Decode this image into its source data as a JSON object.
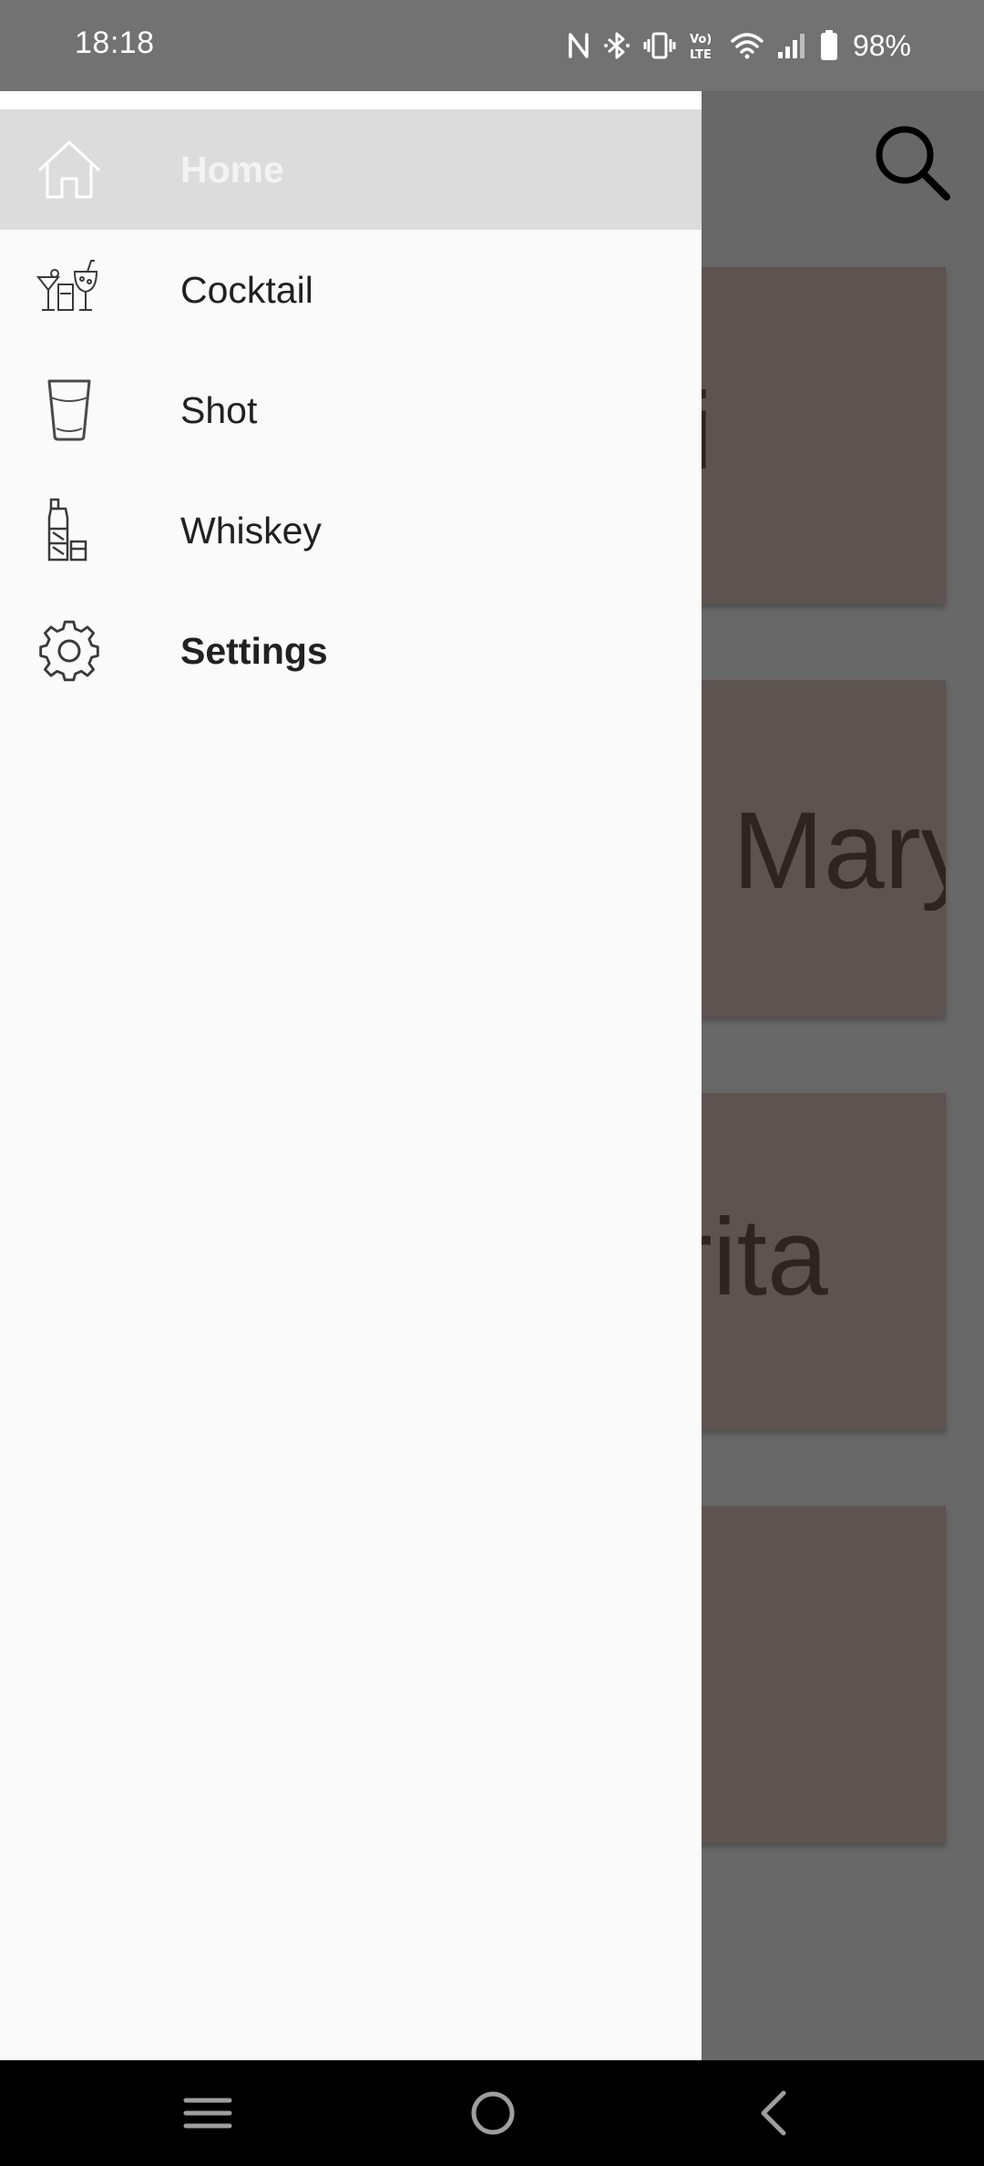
{
  "status_bar": {
    "time": "18:18",
    "battery": "98%",
    "icons": [
      "nfc-icon",
      "bluetooth-icon",
      "vibrate-icon",
      "volte-icon",
      "wifi-icon",
      "signal-icon",
      "battery-icon"
    ]
  },
  "background": {
    "search_icon": "search-icon",
    "cards": [
      {
        "title_fragment": "i"
      },
      {
        "title_fragment": "Mary"
      },
      {
        "title_fragment": "rita"
      },
      {
        "title_fragment": ""
      }
    ]
  },
  "drawer": {
    "items": [
      {
        "label": "Home",
        "icon": "home-icon",
        "selected": true
      },
      {
        "label": "Cocktail",
        "icon": "cocktail-icon"
      },
      {
        "label": "Shot",
        "icon": "shot-glass-icon"
      },
      {
        "label": "Whiskey",
        "icon": "whiskey-icon"
      },
      {
        "label": "Settings",
        "icon": "gear-icon"
      }
    ]
  },
  "system_nav": [
    "recents-icon",
    "home-circle-icon",
    "back-icon"
  ],
  "colors": {
    "drawer_bg": "#fafafa",
    "selected_item_bg": "#dcdcdc",
    "card_bg": "#5d5350",
    "scrim": "#686868"
  }
}
